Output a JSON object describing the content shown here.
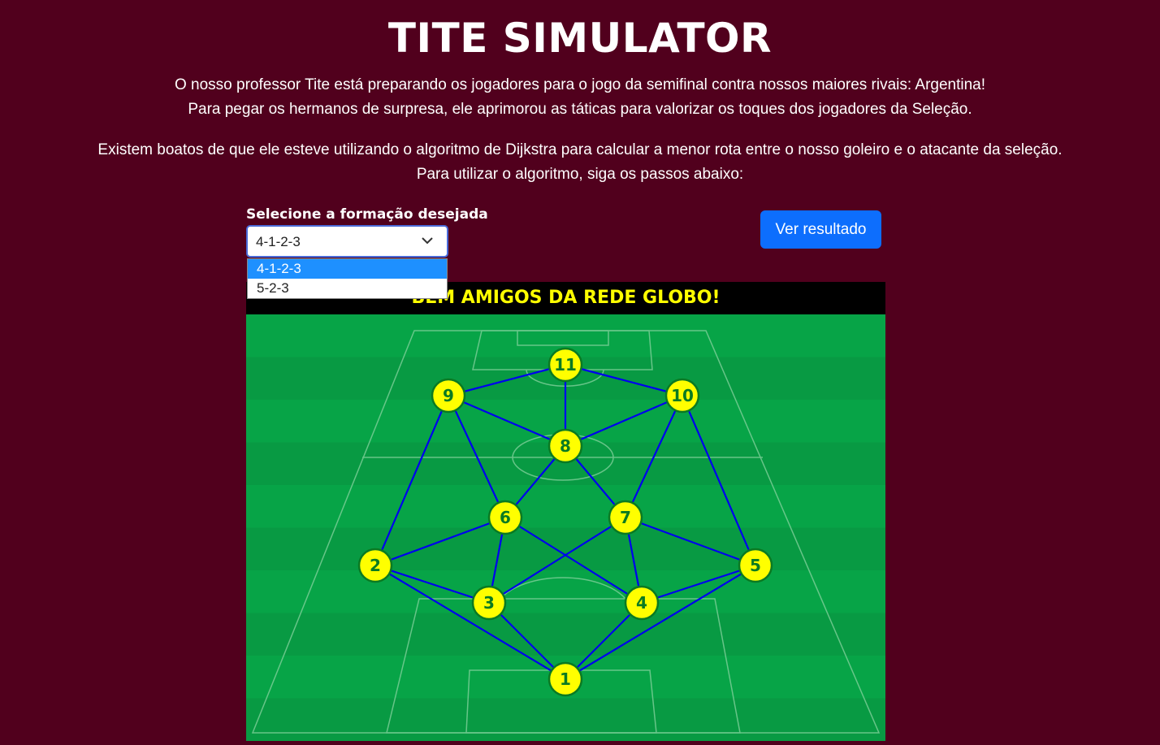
{
  "title": "TITE SIMULATOR",
  "intro": {
    "line1": "O nosso professor Tite está preparando os jogadores para o jogo da semifinal contra nossos maiores rivais: Argentina!",
    "line2": "Para pegar os hermanos de surpresa, ele aprimorou as táticas para valorizar os toques dos jogadores da Seleção.",
    "line3": "Existem boatos de que ele esteve utilizando o algoritmo de Dijkstra para calcular a menor rota entre o nosso goleiro e o atacante da seleção.",
    "line4": "Para utilizar o algoritmo, siga os passos abaixo:"
  },
  "formation": {
    "label": "Selecione a formação desejada",
    "selected": "4-1-2-3",
    "options": [
      "4-1-2-3",
      "5-2-3"
    ]
  },
  "result_button": "Ver resultado",
  "field_header": "BEM AMIGOS DA REDE GLOBO!",
  "colors": {
    "background": "#51001d",
    "pitch": "#07a447",
    "node_fill": "#ffff00",
    "node_text": "#0a7a22",
    "edge": "#0000ee",
    "button": "#0d6efd"
  },
  "players": [
    "1",
    "2",
    "3",
    "4",
    "5",
    "6",
    "7",
    "8",
    "9",
    "10",
    "11"
  ],
  "connections": [
    [
      "1",
      "2"
    ],
    [
      "1",
      "3"
    ],
    [
      "1",
      "4"
    ],
    [
      "1",
      "5"
    ],
    [
      "2",
      "3"
    ],
    [
      "2",
      "6"
    ],
    [
      "2",
      "9"
    ],
    [
      "3",
      "6"
    ],
    [
      "3",
      "7"
    ],
    [
      "4",
      "5"
    ],
    [
      "4",
      "6"
    ],
    [
      "4",
      "7"
    ],
    [
      "5",
      "7"
    ],
    [
      "5",
      "10"
    ],
    [
      "6",
      "8"
    ],
    [
      "6",
      "9"
    ],
    [
      "7",
      "8"
    ],
    [
      "7",
      "10"
    ],
    [
      "8",
      "9"
    ],
    [
      "8",
      "10"
    ],
    [
      "8",
      "11"
    ],
    [
      "9",
      "11"
    ],
    [
      "10",
      "11"
    ]
  ]
}
